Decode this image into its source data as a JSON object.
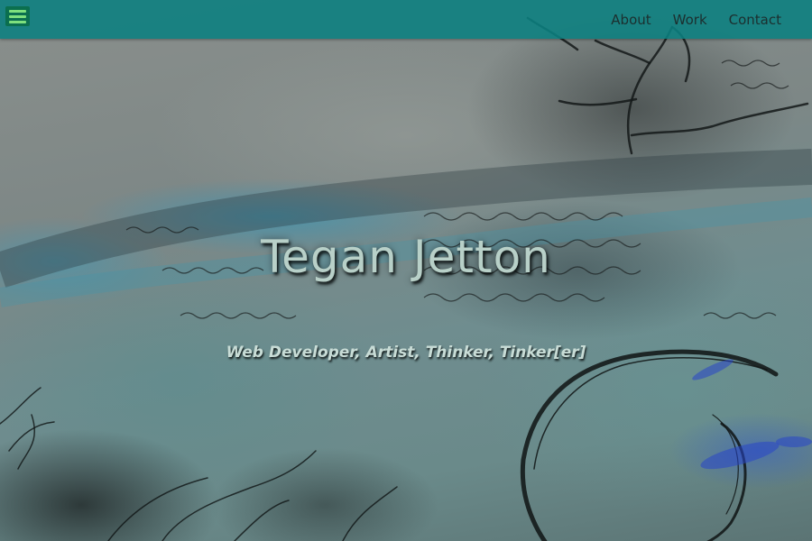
{
  "nav": {
    "menu_icon": "hamburger-menu-icon",
    "links": [
      "About",
      "Work",
      "Contact"
    ]
  },
  "hero": {
    "title": "Tegan Jetton",
    "subtitle": "Web Developer, Artist, Thinker, Tinker[er]"
  },
  "colors": {
    "navbar": "#0a8080",
    "menu_button": "#0b6f4f",
    "menu_lines": "#7ee07e",
    "title_text": "#b8d0c8"
  }
}
